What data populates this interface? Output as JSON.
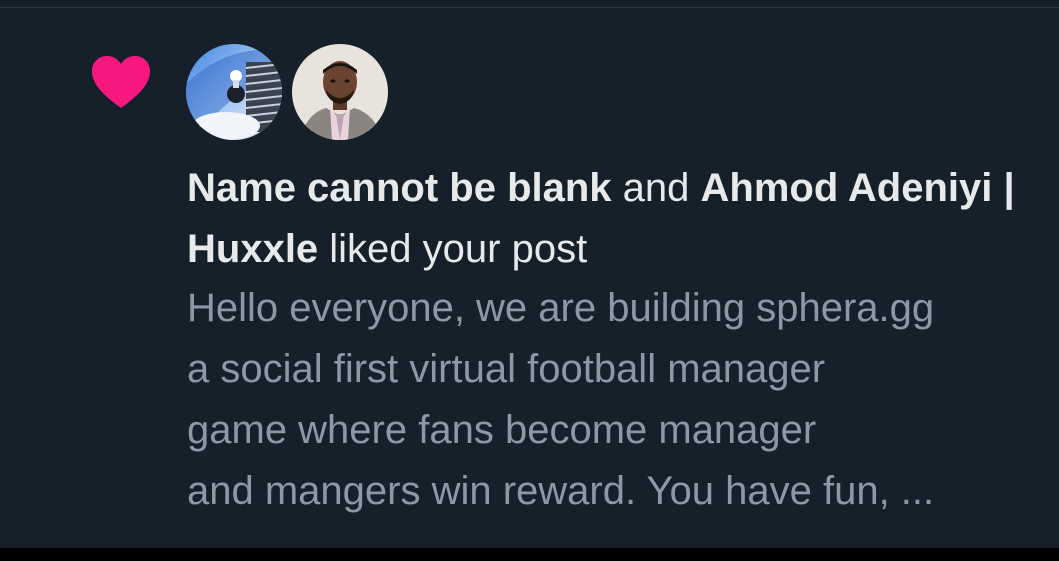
{
  "notification": {
    "icon": "heart-icon",
    "icon_color": "#f91880",
    "actors": [
      {
        "name": "Name cannot be blank",
        "avatar": "avatar-abstract"
      },
      {
        "name": "Ahmod Adeniyi | Huxxle",
        "avatar": "avatar-man-in-suit"
      }
    ],
    "connector": " and ",
    "action": " liked your post",
    "post_preview_lines": [
      "Hello everyone, we are building sphera.gg",
      "a social first virtual football manager",
      "game where fans become manager",
      "and mangers win reward. You have fun, ..."
    ]
  },
  "colors": {
    "background": "#15202b",
    "primary_text": "#e7e9ea",
    "secondary_text": "#8b98a5"
  }
}
